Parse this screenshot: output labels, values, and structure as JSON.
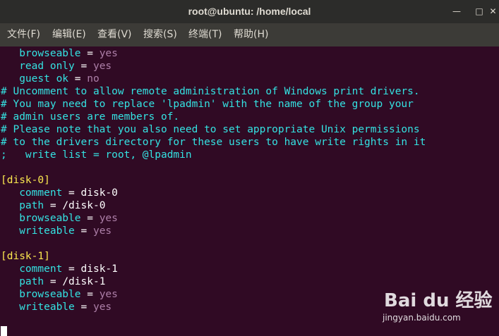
{
  "window": {
    "title": "root@ubuntu: /home/local",
    "controls": {
      "minimize_icon": "minimize-icon",
      "maximize_icon": "maximize-icon",
      "close_icon": "close-icon"
    }
  },
  "menu": [
    {
      "label": "文件(F)"
    },
    {
      "label": "编辑(E)"
    },
    {
      "label": "查看(V)"
    },
    {
      "label": "搜索(S)"
    },
    {
      "label": "终端(T)"
    },
    {
      "label": "帮助(H)"
    }
  ],
  "terminal": {
    "lines": [
      {
        "key": "   browseable",
        "eq": " = ",
        "val": "yes"
      },
      {
        "key": "   read only",
        "eq": " = ",
        "val": "yes"
      },
      {
        "key": "   guest ok",
        "eq": " = ",
        "val": "no"
      },
      {
        "comment": "# Uncomment to allow remote administration of Windows print drivers."
      },
      {
        "comment": "# You may need to replace 'lpadmin' with the name of the group your"
      },
      {
        "comment": "# admin users are members of."
      },
      {
        "comment": "# Please note that you also need to set appropriate Unix permissions"
      },
      {
        "comment": "# to the drivers directory for these users to have write rights in it"
      },
      {
        "comment": ";   write list = root, @lpadmin"
      },
      {
        "blank": ""
      },
      {
        "section": "[disk-0]"
      },
      {
        "key": "   comment",
        "eq": " = ",
        "plain": "disk-0"
      },
      {
        "key": "   path",
        "eq": " = ",
        "plain": "/disk-0"
      },
      {
        "key": "   browseable",
        "eq": " = ",
        "val": "yes"
      },
      {
        "key": "   writeable",
        "eq": " = ",
        "val": "yes"
      },
      {
        "blank": ""
      },
      {
        "section": "[disk-1]"
      },
      {
        "key": "   comment",
        "eq": " = ",
        "plain": "disk-1"
      },
      {
        "key": "   path",
        "eq": " = ",
        "plain": "/disk-1"
      },
      {
        "key": "   browseable",
        "eq": " = ",
        "val": "yes"
      },
      {
        "key": "   writeable",
        "eq": " = ",
        "val": "yes"
      }
    ]
  },
  "watermark": {
    "brand": "Bai du 经验",
    "url": "jingyan.baidu.com"
  }
}
